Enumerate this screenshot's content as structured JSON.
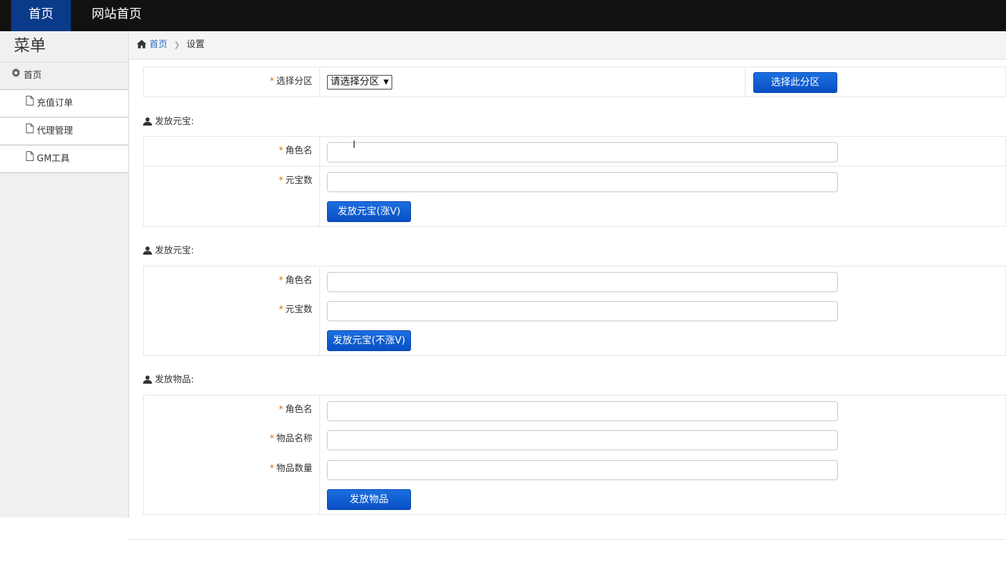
{
  "topnav": [
    {
      "label": "首页",
      "active": true
    },
    {
      "label": "网站首页",
      "active": false
    }
  ],
  "sidebar": {
    "title": "菜单",
    "items": [
      {
        "label": "首页",
        "icon": "gear-icon",
        "level": "root"
      },
      {
        "label": "充值订单",
        "icon": "file-icon",
        "level": "sub"
      },
      {
        "label": "代理管理",
        "icon": "file-icon",
        "level": "sub"
      },
      {
        "label": "GM工具",
        "icon": "file-icon",
        "level": "sub"
      }
    ]
  },
  "breadcrumb": {
    "home": "首页",
    "current": "设置"
  },
  "zone": {
    "label": "选择分区",
    "select_value": "请选择分区",
    "button": "选择此分区"
  },
  "sections": [
    {
      "title": "发放元宝:",
      "fields": [
        {
          "label": "角色名"
        },
        {
          "label": "元宝数"
        }
      ],
      "button": "发放元宝(涨V)"
    },
    {
      "title": "发放元宝:",
      "fields": [
        {
          "label": "角色名"
        },
        {
          "label": "元宝数"
        }
      ],
      "button": "发放元宝(不涨V)"
    },
    {
      "title": "发放物品:",
      "fields": [
        {
          "label": "角色名"
        },
        {
          "label": "物品名称"
        },
        {
          "label": "物品数量"
        }
      ],
      "button": "发放物品"
    }
  ],
  "colors": {
    "topbar": "#111111",
    "active_nav": "#0a3a8a",
    "button": "#0a5bd6",
    "required": "#e06a00",
    "link": "#2a6cc4"
  }
}
